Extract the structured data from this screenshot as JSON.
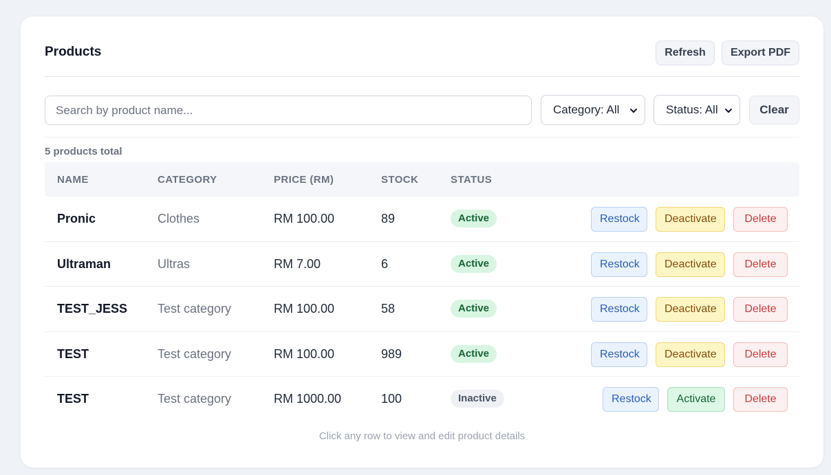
{
  "header": {
    "title": "Products",
    "refresh_label": "Refresh",
    "export_label": "Export PDF"
  },
  "filters": {
    "search_placeholder": "Search by product name...",
    "search_value": "",
    "category_selected": "Category: All",
    "status_selected": "Status: All",
    "clear_label": "Clear"
  },
  "summary": {
    "count_text": "5 products total"
  },
  "table": {
    "columns": [
      "NAME",
      "CATEGORY",
      "PRICE (RM)",
      "STOCK",
      "STATUS"
    ],
    "rows": [
      {
        "name": "Pronic",
        "category": "Clothes",
        "price": "RM 100.00",
        "stock": "89",
        "status": "Active",
        "toggle_label": "Deactivate",
        "restock_label": "Restock",
        "delete_label": "Delete"
      },
      {
        "name": "Ultraman",
        "category": "Ultras",
        "price": "RM 7.00",
        "stock": "6",
        "status": "Active",
        "toggle_label": "Deactivate",
        "restock_label": "Restock",
        "delete_label": "Delete"
      },
      {
        "name": "TEST_JESS",
        "category": "Test category",
        "price": "RM 100.00",
        "stock": "58",
        "status": "Active",
        "toggle_label": "Deactivate",
        "restock_label": "Restock",
        "delete_label": "Delete"
      },
      {
        "name": "TEST",
        "category": "Test category",
        "price": "RM 100.00",
        "stock": "989",
        "status": "Active",
        "toggle_label": "Deactivate",
        "restock_label": "Restock",
        "delete_label": "Delete"
      },
      {
        "name": "TEST",
        "category": "Test category",
        "price": "RM 1000.00",
        "stock": "100",
        "status": "Inactive",
        "toggle_label": "Activate",
        "restock_label": "Restock",
        "delete_label": "Delete"
      }
    ]
  },
  "footer": {
    "hint": "Click any row to view and edit product details"
  },
  "colors": {
    "background": "#eff2f7",
    "active_badge": "#d8f5e2",
    "inactive_badge": "#eef0f4",
    "restock": "#eaf2fe",
    "deactivate": "#fdf6c4",
    "activate": "#dcf7e6",
    "delete": "#fdf0f0"
  },
  "icons": {
    "select_chevron": "chevron-down-icon"
  }
}
